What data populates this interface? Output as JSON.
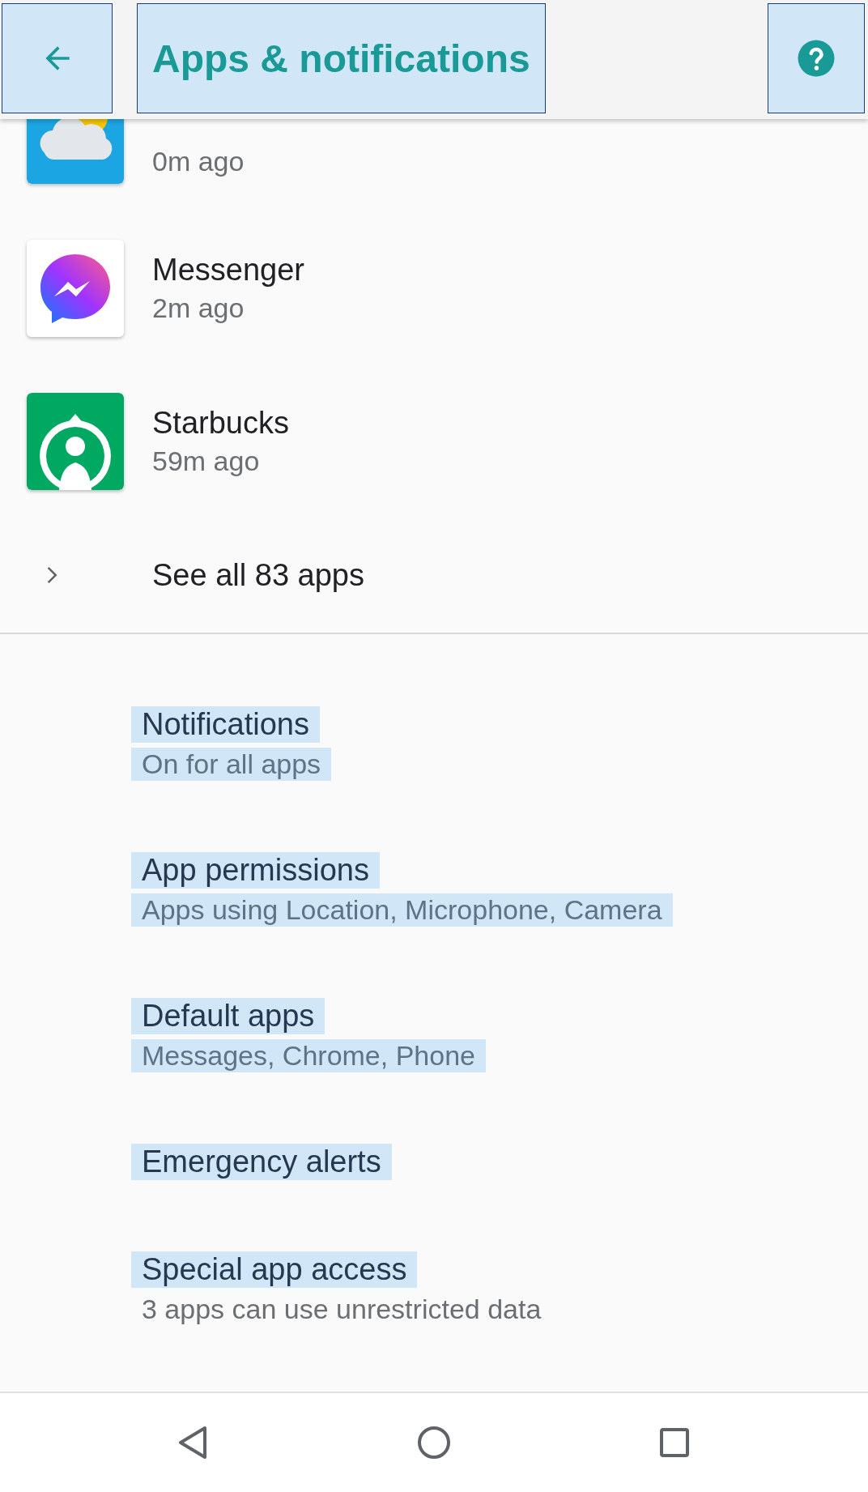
{
  "header": {
    "back_button": {
      "highlighted": true
    },
    "title": {
      "text": "Apps & notifications",
      "highlighted": true
    },
    "help_button": {
      "highlighted": true
    }
  },
  "recent_apps": [
    {
      "kind": "meteored",
      "time": "0m ago"
    },
    {
      "kind": "messenger",
      "name": "Messenger",
      "time": "2m ago"
    },
    {
      "kind": "starbucks",
      "name": "Starbucks",
      "time": "59m ago"
    }
  ],
  "see_all": "See all 83 apps",
  "settings": [
    {
      "title": {
        "text": "Notifications",
        "highlighted": true
      },
      "subtitle": {
        "text": "On for all apps",
        "highlighted": true
      }
    },
    {
      "title": {
        "text": "App permissions",
        "highlighted": true
      },
      "subtitle": {
        "text": "Apps using Location, Microphone, Camera",
        "highlighted": true
      }
    },
    {
      "title": {
        "text": "Default apps",
        "highlighted": true
      },
      "subtitle": {
        "text": "Messages, Chrome, Phone",
        "highlighted": true
      }
    },
    {
      "title": {
        "text": "Emergency alerts",
        "highlighted": true
      }
    },
    {
      "title": {
        "text": "Special app access",
        "highlighted": true
      },
      "subtitle": {
        "text": "3 apps can use unrestricted data",
        "highlighted": false
      }
    }
  ]
}
